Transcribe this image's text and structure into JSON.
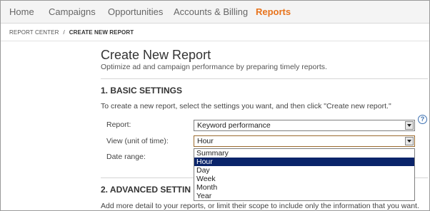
{
  "nav": {
    "items": [
      {
        "label": "Home",
        "active": false
      },
      {
        "label": "Campaigns",
        "active": false
      },
      {
        "label": "Opportunities",
        "active": false
      },
      {
        "label": "Accounts & Billing",
        "active": false
      },
      {
        "label": "Reports",
        "active": true
      }
    ],
    "active_color": "#e8731c"
  },
  "breadcrumb": {
    "parent": "REPORT CENTER",
    "separator": "/",
    "current": "CREATE NEW REPORT"
  },
  "page": {
    "title": "Create New Report",
    "subtitle": "Optimize ad and campaign performance by preparing timely reports."
  },
  "basic_settings": {
    "title": "1. BASIC SETTINGS",
    "instructions": "To create a new report, select the settings you want, and then click \"Create new report.\"",
    "help_icon": "question-circle-icon",
    "report": {
      "label": "Report:",
      "value": "Keyword performance"
    },
    "view": {
      "label": "View (unit of time):",
      "value": "Hour",
      "options": [
        "Summary",
        "Hour",
        "Day",
        "Week",
        "Month",
        "Year"
      ],
      "highlighted": "Hour"
    },
    "date_range": {
      "label": "Date range:"
    }
  },
  "advanced_settings": {
    "title": "2. ADVANCED SETTIN",
    "description": "Add more detail to your reports, or limit their scope to include only the information that you want."
  }
}
